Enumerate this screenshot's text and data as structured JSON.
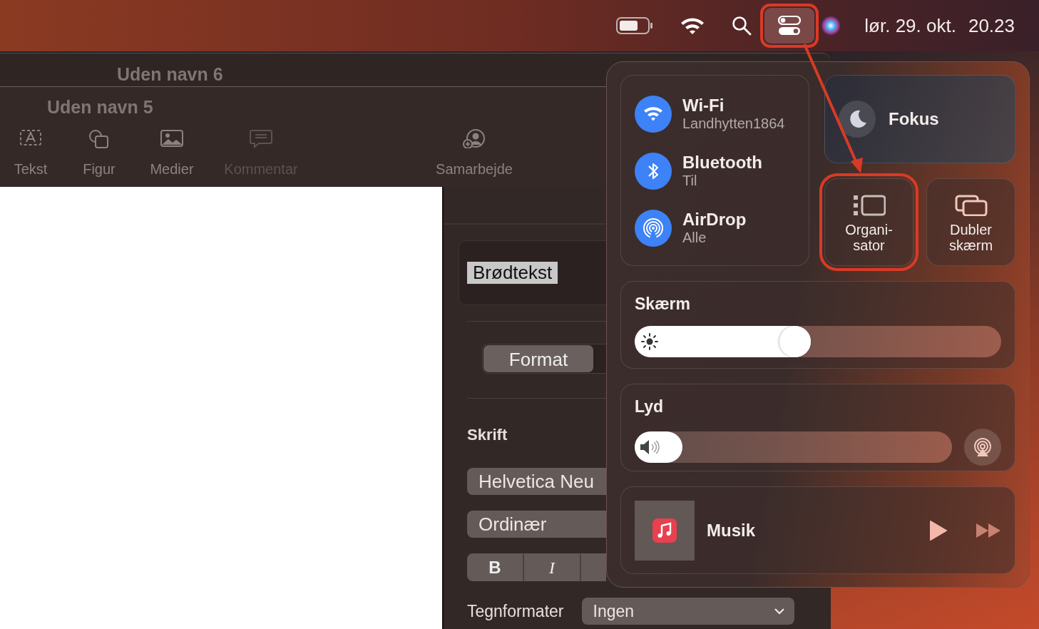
{
  "menu_bar": {
    "control_center_selected": true,
    "date": "lør. 29. okt.",
    "time": "20.23"
  },
  "back_window": {
    "title": "Uden navn 6"
  },
  "front_window": {
    "title": "Uden navn 5",
    "toolbar": [
      {
        "kind": "text",
        "label": "Tekst",
        "disabled": false
      },
      {
        "kind": "shape",
        "label": "Figur",
        "disabled": false
      },
      {
        "kind": "media",
        "label": "Medier",
        "disabled": false
      },
      {
        "kind": "comment",
        "label": "Kommentar",
        "disabled": true
      },
      {
        "kind": "collaborate",
        "label": "Samarbejde",
        "disabled": false
      }
    ],
    "sidebar": {
      "paragraph_style": "Brødtekst",
      "tabs": [
        {
          "label": "Format",
          "selected": true
        }
      ],
      "font_heading": "Skrift",
      "font_family": "Helvetica Neu",
      "font_style": "Ordinær",
      "style_buttons": [
        {
          "kind": "bold",
          "label": "B"
        },
        {
          "kind": "italic",
          "label": "I"
        }
      ],
      "character_styles_label": "Tegnformater",
      "character_styles_value": "Ingen"
    }
  },
  "control_center": {
    "connectivity": [
      {
        "kind": "wifi",
        "title": "Wi-Fi",
        "subtitle": "Landhytten1864",
        "on": true
      },
      {
        "kind": "bluetooth",
        "title": "Bluetooth",
        "subtitle": "Til",
        "on": true
      },
      {
        "kind": "airdrop",
        "title": "AirDrop",
        "subtitle": "Alle",
        "on": true
      }
    ],
    "focus": {
      "label": "Fokus"
    },
    "tiles": [
      {
        "kind": "stage",
        "label": "Organi-sator",
        "highlighted": true
      },
      {
        "kind": "mirror",
        "label": "Dubler skærm",
        "highlighted": false
      }
    ],
    "display": {
      "label": "Skærm",
      "level": 0.48
    },
    "sound": {
      "label": "Lyd",
      "level": 0.15
    },
    "now_playing": {
      "app": "Musik"
    }
  }
}
